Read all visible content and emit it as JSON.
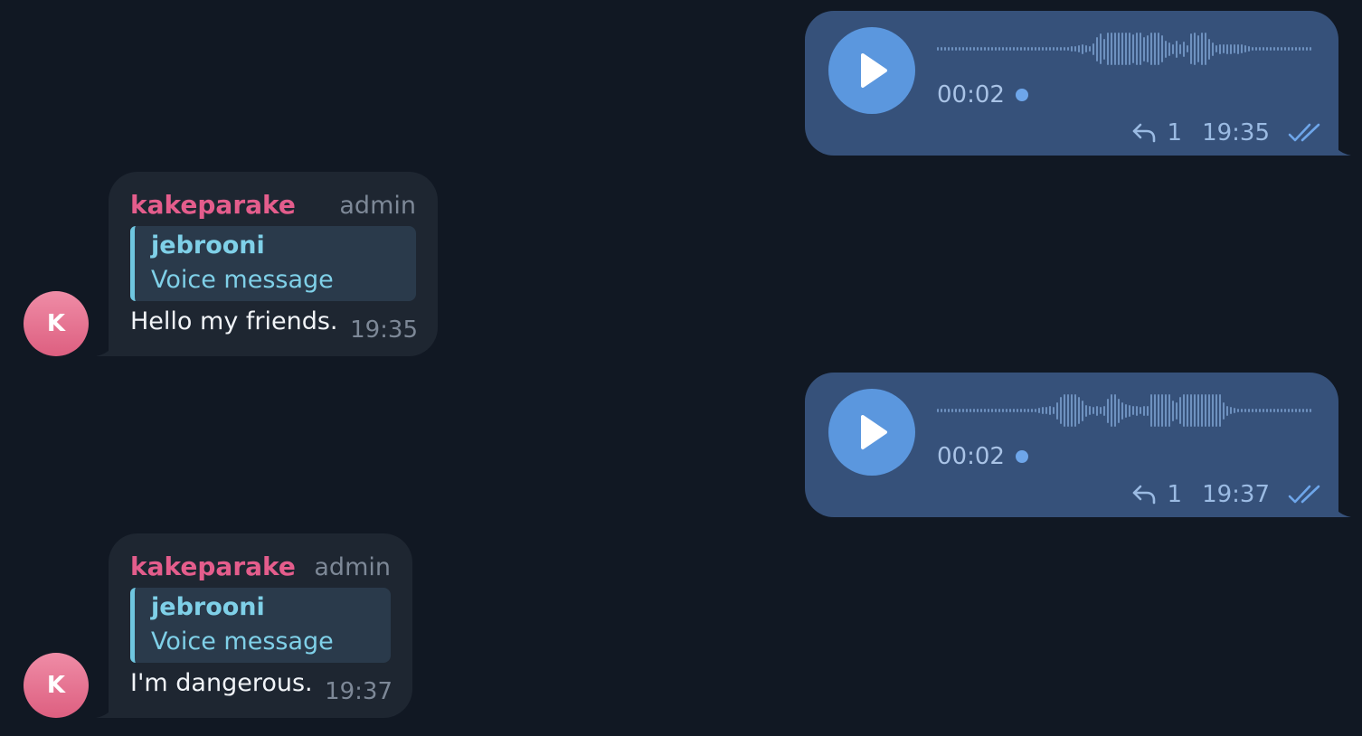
{
  "theme": {
    "background": "#111823",
    "outgoing_bubble": "#36517a",
    "incoming_bubble": "#1e2631",
    "accent_blue": "#5b97de",
    "sender_pink": "#e45d8c",
    "quote_cyan": "#7fd0e8"
  },
  "messages": [
    {
      "type": "voice-outgoing",
      "duration": "00:02",
      "reply_count": "1",
      "time": "19:35",
      "status_icon": "double-check-icon",
      "waveform_levels": [
        0.1,
        0.1,
        0.1,
        0.1,
        0.1,
        0.1,
        0.1,
        0.1,
        0.1,
        0.1,
        0.1,
        0.1,
        0.1,
        0.1,
        0.1,
        0.1,
        0.1,
        0.1,
        0.1,
        0.1,
        0.1,
        0.1,
        0.1,
        0.1,
        0.1,
        0.1,
        0.1,
        0.1,
        0.1,
        0.1,
        0.1,
        0.1,
        0.1,
        0.1,
        0.1,
        0.1,
        0.1,
        0.15,
        0.15,
        0.2,
        0.3,
        0.2,
        0.15,
        0.35,
        0.7,
        0.9,
        0.6,
        0.95,
        0.95,
        0.95,
        0.95,
        0.95,
        0.95,
        0.95,
        0.85,
        0.95,
        0.95,
        0.7,
        0.8,
        0.95,
        0.95,
        0.95,
        0.8,
        0.5,
        0.4,
        0.3,
        0.5,
        0.3,
        0.45,
        0.2,
        0.9,
        0.95,
        0.8,
        0.95,
        0.95,
        0.6,
        0.4,
        0.2,
        0.3,
        0.25,
        0.3,
        0.3,
        0.25,
        0.3,
        0.25,
        0.2,
        0.15,
        0.1,
        0.1,
        0.1,
        0.1,
        0.1,
        0.1,
        0.1,
        0.1,
        0.1,
        0.1,
        0.1,
        0.1,
        0.1,
        0.1,
        0.1,
        0.1,
        0.1
      ]
    },
    {
      "type": "text-incoming",
      "avatar_letter": "K",
      "sender": "kakeparake",
      "role": "admin",
      "quote_author": "jebrooni",
      "quote_text": "Voice message",
      "text": "Hello my friends.",
      "time": "19:35"
    },
    {
      "type": "voice-outgoing",
      "duration": "00:02",
      "reply_count": "1",
      "time": "19:37",
      "status_icon": "double-check-icon",
      "waveform_levels": [
        0.1,
        0.1,
        0.1,
        0.1,
        0.1,
        0.1,
        0.1,
        0.1,
        0.1,
        0.1,
        0.1,
        0.1,
        0.1,
        0.1,
        0.1,
        0.1,
        0.1,
        0.1,
        0.1,
        0.1,
        0.1,
        0.1,
        0.1,
        0.1,
        0.1,
        0.1,
        0.1,
        0.1,
        0.15,
        0.2,
        0.2,
        0.25,
        0.2,
        0.5,
        0.8,
        0.95,
        0.95,
        0.95,
        0.95,
        0.8,
        0.6,
        0.35,
        0.25,
        0.2,
        0.3,
        0.2,
        0.3,
        0.7,
        0.95,
        0.95,
        0.7,
        0.5,
        0.4,
        0.35,
        0.25,
        0.3,
        0.2,
        0.3,
        0.3,
        0.95,
        0.95,
        0.95,
        0.95,
        0.95,
        0.95,
        0.6,
        0.5,
        0.8,
        0.95,
        0.95,
        0.95,
        0.95,
        0.95,
        0.95,
        0.95,
        0.95,
        0.95,
        0.95,
        0.95,
        0.5,
        0.3,
        0.2,
        0.15,
        0.1,
        0.1,
        0.1,
        0.1,
        0.1,
        0.1,
        0.1,
        0.1,
        0.1,
        0.1,
        0.1,
        0.1,
        0.1,
        0.1,
        0.1,
        0.1,
        0.1,
        0.1,
        0.1,
        0.1,
        0.1
      ]
    },
    {
      "type": "text-incoming",
      "avatar_letter": "K",
      "sender": "kakeparake",
      "role": "admin",
      "quote_author": "jebrooni",
      "quote_text": "Voice message",
      "text": "I'm dangerous.",
      "time": "19:37"
    }
  ]
}
